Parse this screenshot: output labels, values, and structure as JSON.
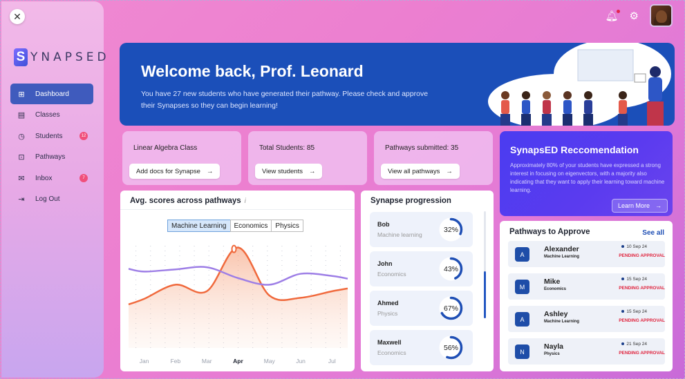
{
  "sidebar": {
    "close_icon": "close-icon",
    "logo_mark": "S",
    "logo_text": "YNAPSED",
    "items": [
      {
        "label": "Dashboard",
        "icon": "⊞",
        "active": true,
        "badge": ""
      },
      {
        "label": "Classes",
        "icon": "▤",
        "badge": ""
      },
      {
        "label": "Students",
        "icon": "◷",
        "badge": "12"
      },
      {
        "label": "Pathways",
        "icon": "⊡",
        "badge": ""
      },
      {
        "label": "Inbox",
        "icon": "✉",
        "badge": "7"
      },
      {
        "label": "Log Out",
        "icon": "⇥",
        "badge": ""
      }
    ]
  },
  "topbar": {
    "bell_icon": "bell-icon",
    "gear_icon": "gear-icon"
  },
  "welcome": {
    "title": "Welcome back, Prof. Leonard",
    "text": "You have 27 new students who have generated their pathway. Please check and approve their Synapses so they can begin learning!"
  },
  "stats": [
    {
      "title": "Linear Algebra Class",
      "button": "Add docs for Synapse"
    },
    {
      "title": "Total Students: 85",
      "button": "View students"
    },
    {
      "title": "Pathways submitted: 35",
      "button": "View all pathways"
    }
  ],
  "recommendation": {
    "title": "SynapsED Reccomendation",
    "text": "Approximately 80% of your students have expressed a strong interest in focusing on eigenvectors, with a majority also indicating that they want to apply their learning toward machine learning.",
    "button": "Learn More"
  },
  "scores": {
    "title": "Avg. scores across pathways",
    "info_icon": "i",
    "tabs": [
      "Machine Learning",
      "Economics",
      "Physics"
    ],
    "active_tab": 0
  },
  "chart_data": {
    "type": "line",
    "categories": [
      "Jan",
      "Feb",
      "Mar",
      "Apr",
      "May",
      "Jun",
      "Jul"
    ],
    "highlight_category": "Apr",
    "series": [
      {
        "values": [
          45,
          58,
          52,
          92,
          48,
          46,
          52
        ],
        "color": "#f0693c",
        "area": true
      },
      {
        "values": [
          70,
          72,
          74,
          64,
          58,
          68,
          66
        ],
        "color": "#9d7ee6",
        "area": false
      }
    ],
    "ylim": [
      0,
      100
    ],
    "grid": "dotted-vertical"
  },
  "progression": {
    "title": "Synapse progression",
    "items": [
      {
        "name": "Bob",
        "subject": "Machine learning",
        "pct_label": "32%",
        "pct": 32
      },
      {
        "name": "John",
        "subject": "Economics",
        "pct_label": "43%",
        "pct": 43
      },
      {
        "name": "Ahmed",
        "subject": "Physics",
        "pct_label": "67%",
        "pct": 67
      },
      {
        "name": "Maxwell",
        "subject": "Economics",
        "pct_label": "56%",
        "pct": 56
      }
    ]
  },
  "approve": {
    "title": "Pathways to Approve",
    "see_all": "See all",
    "rows": [
      {
        "initial": "A",
        "name": "Alexander",
        "class": "Machine Learning",
        "date": "10 Sep 24",
        "status": "PENDING APPROVAL"
      },
      {
        "initial": "M",
        "name": "Mike",
        "class": "Economics",
        "date": "15 Sep 24",
        "status": "PENDING APPROVAL"
      },
      {
        "initial": "A",
        "name": "Ashley",
        "class": "Machine Learning",
        "date": "15 Sep 24",
        "status": "PENDING APPROVAL"
      },
      {
        "initial": "N",
        "name": "Nayla",
        "class": "Physics",
        "date": "21 Sep 24",
        "status": "PENDING APPROVAL"
      }
    ]
  },
  "colors": {
    "primary": "#1b4fb9",
    "accent": "#4a3cf0",
    "danger": "#e0243d"
  }
}
